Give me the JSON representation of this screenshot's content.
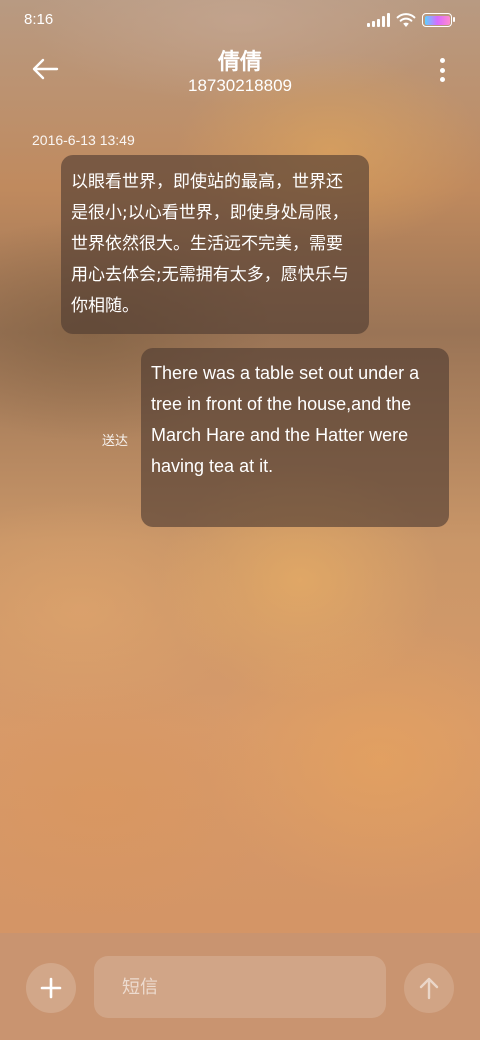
{
  "status_bar": {
    "time": "8:16",
    "icons": [
      "signal-icon",
      "wifi-icon",
      "battery-icon"
    ]
  },
  "header": {
    "contact_name": "倩倩",
    "contact_number": "18730218809",
    "icons": [
      "back-arrow-icon",
      "more-vert-icon"
    ]
  },
  "messages": [
    {
      "timestamp": "2016-6-13 13:49",
      "direction": "incoming",
      "text": "以眼看世界，即使站的最高，世界还是很小;以心看世界，即使身处局限，世界依然很大。生活远不完美，需要用心去体会;无需拥有太多，愿快乐与你相随。"
    },
    {
      "direction": "outgoing",
      "status": "送达",
      "text": "There was a table set out under a tree in front of the house,and the March Hare and the Hatter were having tea at it."
    }
  ],
  "composer": {
    "placeholder": "短信",
    "value": "",
    "icons": [
      "add-icon",
      "send-arrow-up-icon"
    ]
  },
  "colors": {
    "bubble": "#4e3a30",
    "bottom_bar": "#c99470",
    "text": "#ffffff"
  }
}
